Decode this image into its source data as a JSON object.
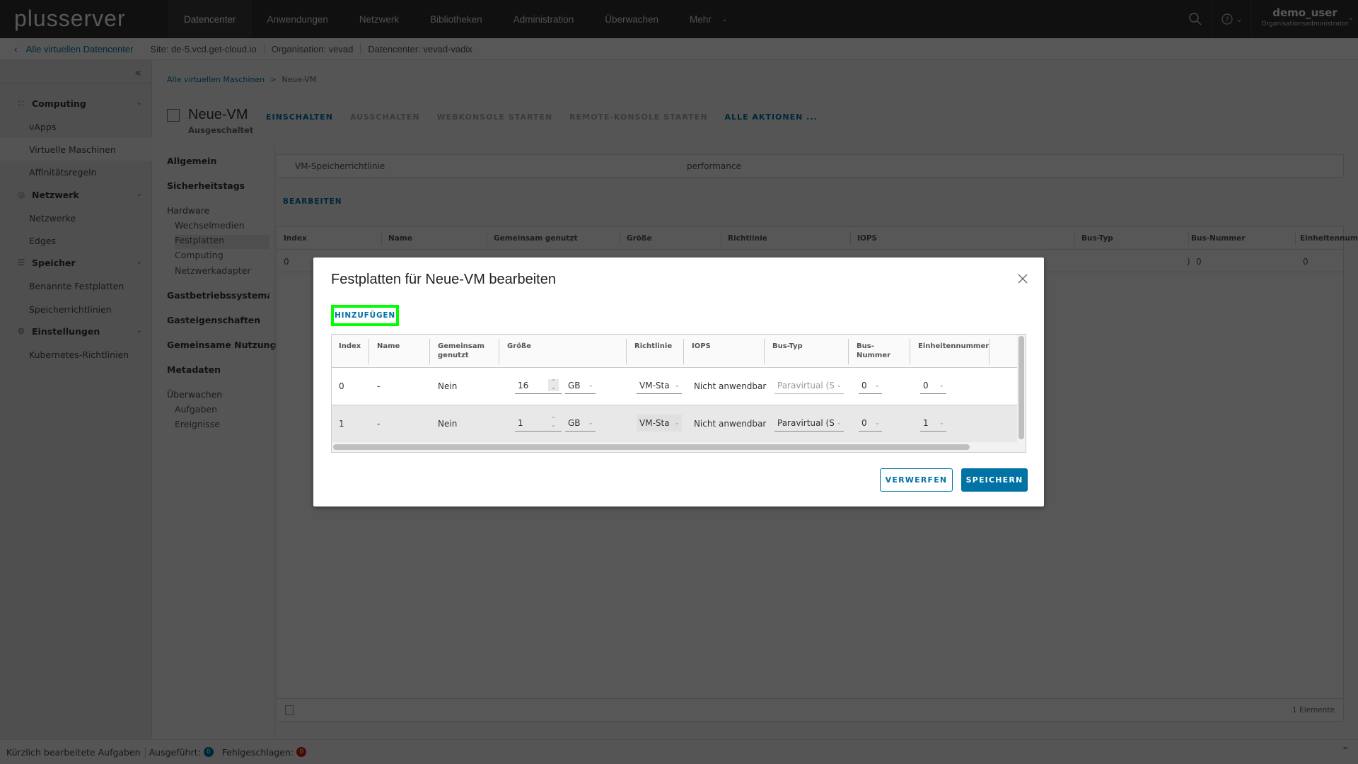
{
  "header": {
    "logo": "plusserver",
    "nav": [
      {
        "label": "Datencenter",
        "active": true
      },
      {
        "label": "Anwendungen"
      },
      {
        "label": "Netzwerk"
      },
      {
        "label": "Bibliotheken"
      },
      {
        "label": "Administration"
      },
      {
        "label": "Überwachen"
      },
      {
        "label": "Mehr"
      }
    ],
    "user": {
      "name": "demo_user",
      "role": "Organisationsadministrator"
    },
    "icons": {
      "search": "search-icon",
      "help": "help-icon",
      "chevron": "chevron-down-icon"
    }
  },
  "context": {
    "back_label": "Alle virtuellen Datencenter",
    "site": "Site: de-5.vcd.get-cloud.io",
    "org": "Organisation: vevad",
    "dc": "Datencenter: vevad-vadix"
  },
  "sidebar": {
    "groups": [
      {
        "label": "Computing",
        "icon": "grid-icon",
        "items": [
          "vApps",
          "Virtuelle Maschinen",
          "Affinitätsregeln"
        ]
      },
      {
        "label": "Netzwerk",
        "icon": "network-icon",
        "items": [
          "Netzwerke",
          "Edges"
        ]
      },
      {
        "label": "Speicher",
        "icon": "database-icon",
        "items": [
          "Benannte Festplatten",
          "Speicherrichtlinien"
        ]
      },
      {
        "label": "Einstellungen",
        "icon": "gear-icon",
        "items": [
          "Kubernetes-Richtlinien"
        ]
      }
    ],
    "active_item": "Virtuelle Maschinen"
  },
  "main": {
    "breadcrumb": {
      "parent": "Alle virtuellen Maschinen",
      "sep": ">",
      "current": "Neue-VM"
    },
    "vm_name": "Neue-VM",
    "vm_state": "Ausgeschaltet",
    "actions": [
      {
        "label": "EINSCHALTEN",
        "enabled": true
      },
      {
        "label": "AUSSCHALTEN",
        "enabled": false
      },
      {
        "label": "WEBKONSOLE STARTEN",
        "enabled": false
      },
      {
        "label": "REMOTE-KONSOLE STARTEN",
        "enabled": false
      },
      {
        "label": "ALLE AKTIONEN ...",
        "enabled": true
      }
    ],
    "detail_nav": {
      "allgemein": "Allgemein",
      "sicherheitstags": "Sicherheitstags",
      "hardware": "Hardware",
      "wechselmedien": "Wechselmedien",
      "festplatten": "Festplatten",
      "computing": "Computing",
      "netzwerkadapter": "Netzwerkadapter",
      "gastbs": "Gastbetriebssystemanp",
      "gasteig": "Gasteigenschaften",
      "gemeinsam": "Gemeinsame Nutzung",
      "metadaten": "Metadaten",
      "ueberwachen": "Überwachen",
      "aufgaben": "Aufgaben",
      "ereignisse": "Ereignisse"
    },
    "policy": {
      "label": "VM-Speicherrichtlinie",
      "value": "performance"
    },
    "edit_label": "BEARBEITEN",
    "table": {
      "columns": [
        "Index",
        "Name",
        "Gemeinsam genutzt",
        "Größe",
        "Richtlinie",
        "IOPS",
        "Bus-Typ",
        "Bus-Nummer",
        "Einheitennummer"
      ],
      "row": {
        "index": "0",
        "bus_nummer": "0",
        "einheit": "0",
        "bus_typ_tail": ")"
      },
      "footer_count": "1 Elemente"
    }
  },
  "modal": {
    "title": "Festplatten für Neue-VM bearbeiten",
    "add_label": "HINZUFÜGEN",
    "columns": {
      "index": "Index",
      "name": "Name",
      "shared": "Gemeinsam genutzt",
      "size": "Größe",
      "policy": "Richtlinie",
      "iops": "IOPS",
      "bus_type": "Bus-Typ",
      "bus_number": "Bus-Nummer",
      "unit_number": "Einheitennummer"
    },
    "rows": [
      {
        "index": "0",
        "name": "-",
        "shared": "Nein",
        "size": "16",
        "unit": "GB",
        "policy": "VM-Sta",
        "iops": "Nicht anwendbar",
        "bus_type": "Paravirtual (S",
        "bus_number": "0",
        "unit_number": "0"
      },
      {
        "index": "1",
        "name": "-",
        "shared": "Nein",
        "size": "1",
        "unit": "GB",
        "policy": "VM-Sta",
        "iops": "Nicht anwendbar",
        "bus_type": "Paravirtual (S",
        "bus_number": "0",
        "unit_number": "1"
      }
    ],
    "cancel_label": "VERWERFEN",
    "save_label": "SPEICHERN"
  },
  "statusbar": {
    "title": "Kürzlich bearbeitete Aufgaben",
    "running_label": "Ausgeführt:",
    "running_count": "0",
    "failed_label": "Fehlgeschlagen:",
    "failed_count": "0"
  },
  "colors": {
    "accent": "#0072a3",
    "highlight": "#00ff00",
    "error": "#c92100",
    "header": "#313131"
  }
}
